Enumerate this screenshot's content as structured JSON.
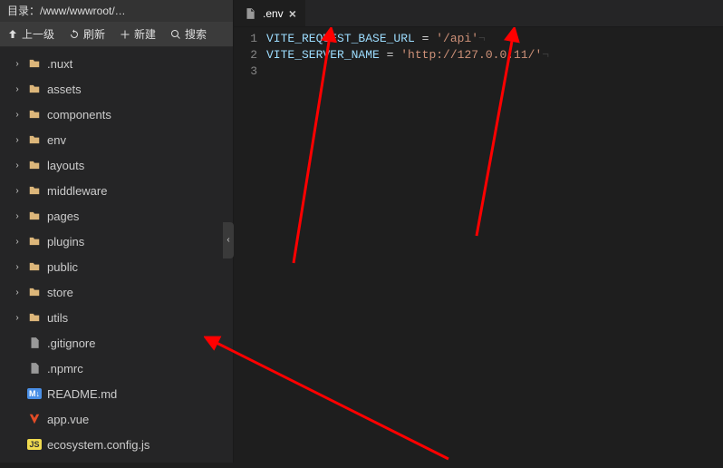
{
  "path": "目录：/www/wwwroot/…",
  "toolbar": {
    "up": "上一级",
    "refresh": "刷新",
    "new": "新建",
    "search": "搜索"
  },
  "tree": {
    "items": [
      {
        "type": "folder",
        "label": ".nuxt",
        "expandable": true
      },
      {
        "type": "folder",
        "label": "assets",
        "expandable": true
      },
      {
        "type": "folder",
        "label": "components",
        "expandable": true
      },
      {
        "type": "folder",
        "label": "env",
        "expandable": true
      },
      {
        "type": "folder",
        "label": "layouts",
        "expandable": true
      },
      {
        "type": "folder",
        "label": "middleware",
        "expandable": true
      },
      {
        "type": "folder",
        "label": "pages",
        "expandable": true
      },
      {
        "type": "folder",
        "label": "plugins",
        "expandable": true
      },
      {
        "type": "folder",
        "label": "public",
        "expandable": true
      },
      {
        "type": "folder",
        "label": "store",
        "expandable": true
      },
      {
        "type": "folder",
        "label": "utils",
        "expandable": true
      },
      {
        "type": "file",
        "label": ".gitignore",
        "icon": "generic"
      },
      {
        "type": "file",
        "label": ".npmrc",
        "icon": "generic"
      },
      {
        "type": "file",
        "label": "README.md",
        "icon": "md"
      },
      {
        "type": "file",
        "label": "app.vue",
        "icon": "vue"
      },
      {
        "type": "file",
        "label": "ecosystem.config.js",
        "icon": "js"
      }
    ]
  },
  "tab": {
    "filename": ".env"
  },
  "code": {
    "lines": [
      {
        "n": "1",
        "var": "VITE_REQUEST_BASE_URL",
        "val": "'/api'"
      },
      {
        "n": "2",
        "var": "VITE_SERVER_NAME",
        "val": "'http://127.0.0.11/'"
      },
      {
        "n": "3",
        "var": "",
        "val": ""
      }
    ]
  }
}
